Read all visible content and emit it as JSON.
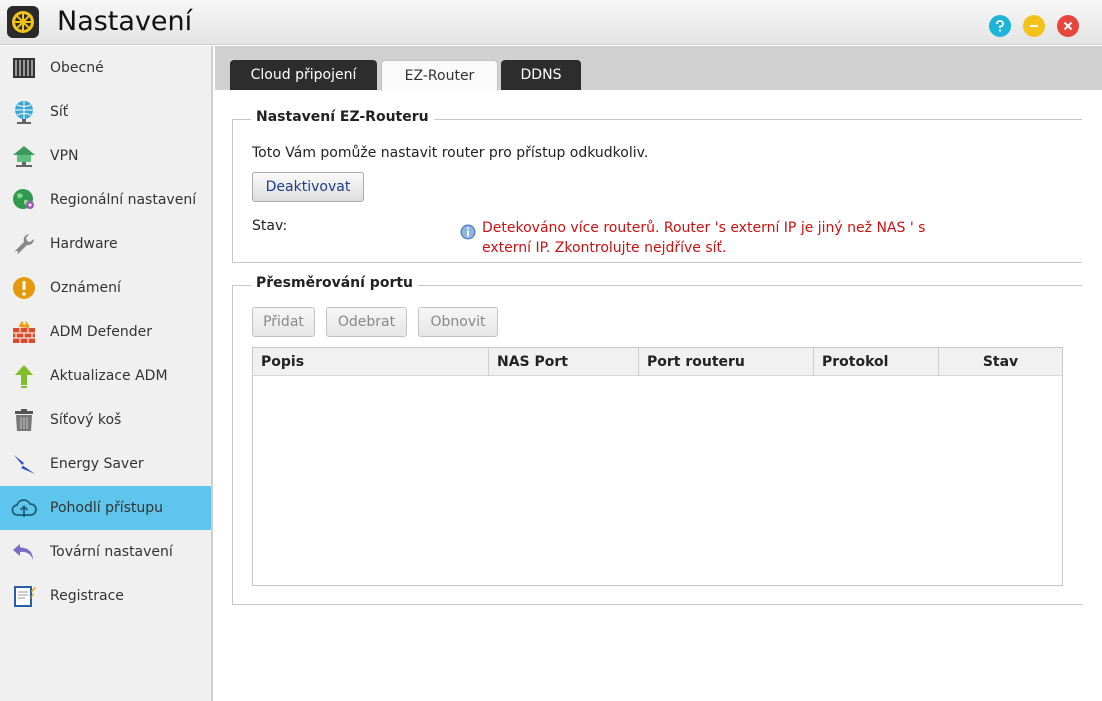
{
  "window": {
    "title": "Nastavení"
  },
  "sidebar": {
    "items": [
      {
        "label": "Obecné",
        "icon": "nas-device-icon"
      },
      {
        "label": "Síť",
        "icon": "globe-network-icon"
      },
      {
        "label": "VPN",
        "icon": "vpn-house-icon"
      },
      {
        "label": "Regionální nastavení",
        "icon": "regional-globe-icon"
      },
      {
        "label": "Hardware",
        "icon": "wrench-icon"
      },
      {
        "label": "Oznámení",
        "icon": "alert-icon"
      },
      {
        "label": "ADM Defender",
        "icon": "firewall-icon"
      },
      {
        "label": "Aktualizace ADM",
        "icon": "update-arrow-icon"
      },
      {
        "label": "Síťový koš",
        "icon": "trash-icon"
      },
      {
        "label": "Energy Saver",
        "icon": "lightning-icon"
      },
      {
        "label": "Pohodlí přístupu",
        "icon": "cloud-upload-icon"
      },
      {
        "label": "Tovární nastavení",
        "icon": "undo-arrow-icon"
      },
      {
        "label": "Registrace",
        "icon": "clipboard-icon"
      }
    ],
    "active_index": 10
  },
  "tabs": [
    {
      "label": "Cloud připojení",
      "active": false
    },
    {
      "label": "EZ-Router",
      "active": true
    },
    {
      "label": "DDNS",
      "active": false
    }
  ],
  "ez_router": {
    "legend": "Nastavení EZ-Routeru",
    "description": "Toto Vám pomůže nastavit router pro přístup odkudkoliv.",
    "deactivate_label": "Deaktivovat",
    "status_label": "Stav:",
    "status_line1": "Detekováno více routerů. Router 's externí IP je jiný než NAS ' s",
    "status_line2": "externí IP. Zkontrolujte nejdříve síť."
  },
  "port_forwarding": {
    "legend": "Přesměrování portu",
    "add_label": "Přidat",
    "remove_label": "Odebrat",
    "refresh_label": "Obnovit",
    "columns": [
      "Popis",
      "NAS Port",
      "Port routeru",
      "Protokol",
      "Stav"
    ],
    "rows": []
  },
  "colors": {
    "active_nav": "#5ec6ec",
    "error_text": "#cc1111",
    "help_button": "#1eb4d8",
    "minimize_button": "#f3c21b",
    "close_button": "#e8453c"
  }
}
